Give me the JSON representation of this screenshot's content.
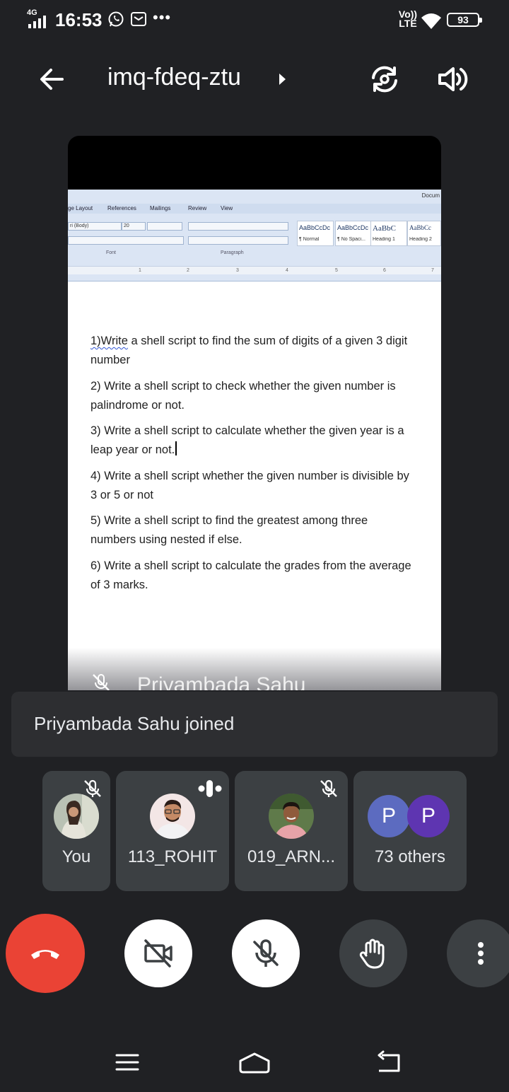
{
  "status_bar": {
    "network": "4G",
    "time": "16:53",
    "more_indicator": "•••",
    "volte_top": "Vo))",
    "volte_bottom": "LTE",
    "battery": "93",
    "icons": [
      "signal-icon",
      "whatsapp-icon",
      "message-icon",
      "wifi-icon",
      "battery-icon"
    ]
  },
  "top_bar": {
    "meeting_code": "imq-fdeq-ztu",
    "icons": [
      "back-arrow-icon",
      "caret-right-icon",
      "switch-camera-icon",
      "speaker-icon"
    ]
  },
  "presentation": {
    "presenter_name": "Priyambada Sahu",
    "document": {
      "window_title": "Docum",
      "ribbon_tabs": [
        "ge Layout",
        "References",
        "Mailings",
        "Review",
        "View"
      ],
      "font_name": "ri (Body)",
      "font_size": "20",
      "group_labels": [
        "Font",
        "Paragraph"
      ],
      "styles": [
        {
          "sample": "AaBbCcDc",
          "name": "¶ Normal"
        },
        {
          "sample": "AaBbCcDc",
          "name": "¶ No Spaci..."
        },
        {
          "sample": "AaBbC",
          "name": "Heading 1"
        },
        {
          "sample": "AaBbCc",
          "name": "Heading 2"
        }
      ],
      "ruler_numbers": [
        "1",
        "2",
        "3",
        "4",
        "5",
        "6",
        "7"
      ],
      "first_item_first_word": "1)Write",
      "first_item_rest": " a shell script to find the sum of digits of a given 3 digit number",
      "items": [
        "2) Write a shell script to check whether the given number is palindrome or not.",
        "3) Write a shell script to calculate whether the given year is a leap year or not.",
        "4) Write a shell script whether the given number is divisible by 3 or 5 or not",
        "5) Write a shell script to find the greatest among three numbers using nested if else.",
        "6) Write a shell script to calculate the grades from the average of 3 marks."
      ]
    }
  },
  "toast": {
    "message": "Priyambada Sahu joined"
  },
  "participants": [
    {
      "name": "You",
      "muted": true
    },
    {
      "name": "113_ROHIT",
      "speaking": true
    },
    {
      "name": "019_ARN...",
      "muted": true
    },
    {
      "name": "73 others",
      "initials": [
        "P",
        "P"
      ],
      "initial_colors": [
        "#5c6bc0",
        "#5e35b1"
      ]
    }
  ],
  "controls": {
    "icons": [
      "end-call-icon",
      "camera-off-icon",
      "mic-off-icon",
      "raise-hand-icon",
      "more-vert-icon"
    ],
    "end_call_color": "#ea4335"
  },
  "nav_bar": {
    "icons": [
      "menu-icon",
      "home-icon",
      "back-icon"
    ]
  }
}
